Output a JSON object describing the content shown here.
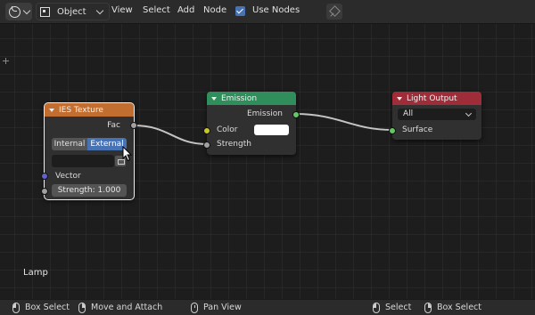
{
  "header": {
    "editor_type_icon": "node-editor-icon",
    "mode": {
      "label": "Object",
      "icon": "cube-icon"
    },
    "menus": [
      "View",
      "Select",
      "Add",
      "Node"
    ],
    "use_nodes": {
      "label": "Use Nodes",
      "checked": true
    },
    "pin_icon": "pin-icon"
  },
  "nodes": {
    "ies": {
      "title": "IES Texture",
      "header_color": "#c26e30",
      "output": "Fac",
      "mode_options": [
        "Internal",
        "External"
      ],
      "mode_selected": "External",
      "filepath": "",
      "input": "Vector",
      "strength": "Strength: 1.000"
    },
    "emission": {
      "title": "Emission",
      "header_color": "#2f8e5c",
      "output": "Emission",
      "inputs": [
        "Color",
        "Strength"
      ],
      "color_value": "#ffffff"
    },
    "light_output": {
      "title": "Light Output",
      "header_color": "#9e2d39",
      "target": "All",
      "input": "Surface"
    }
  },
  "canvas": {
    "object_label": "Lamp"
  },
  "status_bar": {
    "items": [
      {
        "icon": "mouse-left-icon",
        "label": "Box Select"
      },
      {
        "icon": "mouse-right-icon",
        "label": "Move and Attach"
      },
      {
        "icon": "mouse-middle-icon",
        "label": "Pan View"
      },
      {
        "icon": "mouse-left-icon",
        "label": "Select"
      },
      {
        "icon": "mouse-right-icon",
        "label": "Box Select"
      }
    ]
  }
}
